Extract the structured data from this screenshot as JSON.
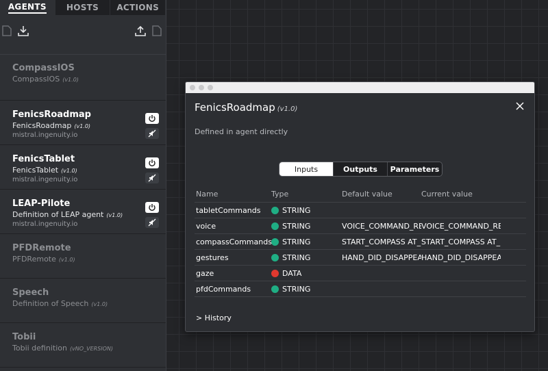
{
  "tabs": [
    {
      "label": "AGENTS",
      "active": true
    },
    {
      "label": "HOSTS",
      "active": false
    },
    {
      "label": "ACTIONS",
      "active": false
    }
  ],
  "toolbar": {
    "icons": [
      "new-file-icon",
      "download-icon",
      "upload-icon",
      "file-icon"
    ]
  },
  "agents": [
    {
      "name": "CompassIOS",
      "definition": "CompassIOS",
      "version": "(v1.0)",
      "host": "",
      "active": false
    },
    {
      "name": "FenicsRoadmap",
      "definition": "FenicsRoadmap",
      "version": "(v1.0)",
      "host": "mistral.ingenuity.io",
      "active": true
    },
    {
      "name": "FenicsTablet",
      "definition": "FenicsTablet",
      "version": "(v1.0)",
      "host": "mistral.ingenuity.io",
      "active": true
    },
    {
      "name": "LEAP-Pilote",
      "definition": "Definition of LEAP agent",
      "version": "(v1.0)",
      "host": "mistral.ingenuity.io",
      "active": true
    },
    {
      "name": "PFDRemote",
      "definition": "PFDRemote",
      "version": "(v1.0)",
      "host": "",
      "active": false
    },
    {
      "name": "Speech",
      "definition": "Definition of Speech",
      "version": "(v1.0)",
      "host": "",
      "active": false
    },
    {
      "name": "Tobii",
      "definition": "Tobii definition",
      "version": "(vNO_VERSION)",
      "host": "",
      "active": false
    }
  ],
  "modal": {
    "title": "FenicsRoadmap",
    "version": "(v1.0)",
    "description": "Defined in agent directly",
    "segments": [
      {
        "label": "Inputs",
        "active": true
      },
      {
        "label": "Outputs",
        "active": false
      },
      {
        "label": "Parameters",
        "active": false
      }
    ],
    "columns": {
      "name": "Name",
      "type": "Type",
      "default": "Default value",
      "current": "Current value"
    },
    "rows": [
      {
        "name": "tabletCommands",
        "type": "STRING",
        "color": "#1fae84",
        "default": "",
        "current": ""
      },
      {
        "name": "voice",
        "type": "STRING",
        "color": "#1fae84",
        "default": "VOICE_COMMAND_RE...",
        "current": "VOICE_COMMAND_RE..."
      },
      {
        "name": "compassCommands",
        "type": "STRING",
        "color": "#1fae84",
        "default": "START_COMPASS AT_...",
        "current": "START_COMPASS AT_..."
      },
      {
        "name": "gestures",
        "type": "STRING",
        "color": "#1fae84",
        "default": "HAND_DID_DISAPPEA...",
        "current": "HAND_DID_DISAPPEA..."
      },
      {
        "name": "gaze",
        "type": "DATA",
        "color": "#e0392f",
        "default": "",
        "current": ""
      },
      {
        "name": "pfdCommands",
        "type": "STRING",
        "color": "#1fae84",
        "default": "",
        "current": ""
      }
    ],
    "history_label": "> History"
  }
}
